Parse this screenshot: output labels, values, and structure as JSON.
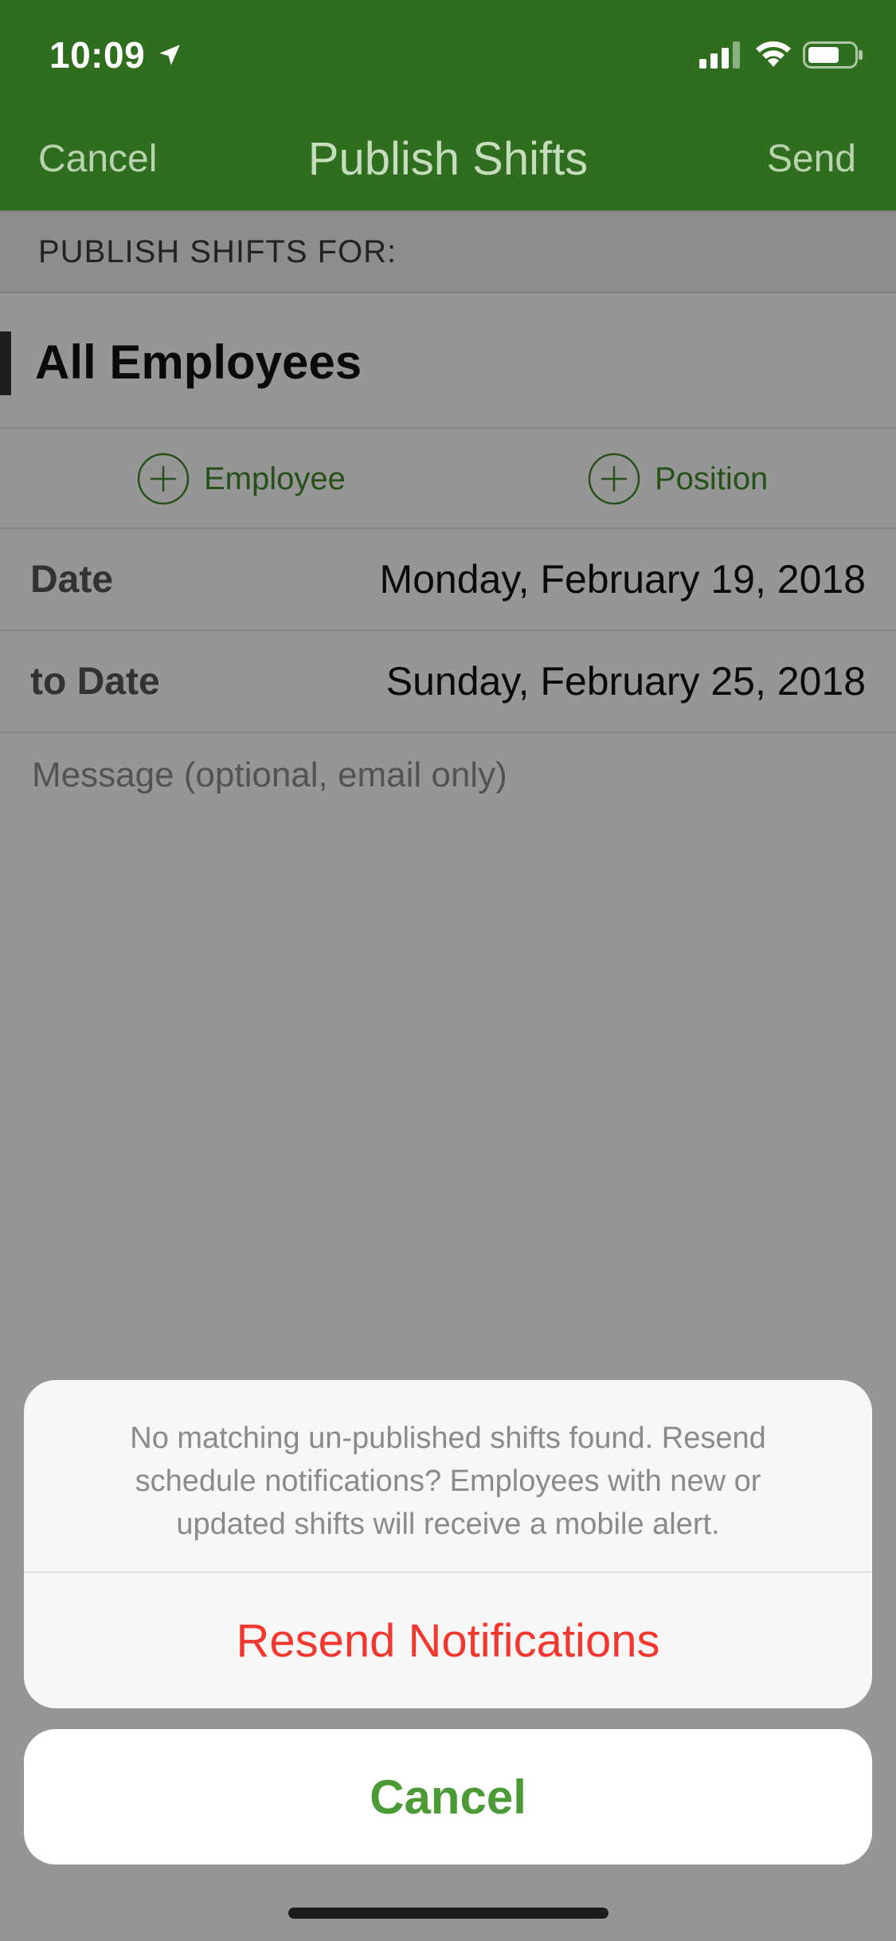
{
  "status_bar": {
    "time": "10:09"
  },
  "nav": {
    "cancel_label": "Cancel",
    "title": "Publish Shifts",
    "send_label": "Send"
  },
  "form": {
    "section_header": "PUBLISH SHIFTS FOR:",
    "all_employees": "All Employees",
    "add_employee_label": "Employee",
    "add_position_label": "Position",
    "date_label": "Date",
    "date_value": "Monday, February 19, 2018",
    "to_date_label": "to Date",
    "to_date_value": "Sunday, February 25, 2018",
    "message_placeholder": "Message (optional, email only)"
  },
  "action_sheet": {
    "message": "No matching un-published shifts found. Resend schedule notifications? Employees with new or updated shifts will receive a mobile alert.",
    "resend_label": "Resend Notifications",
    "cancel_label": "Cancel"
  },
  "colors": {
    "nav_green": "#2f6e1f",
    "accent_green": "#4b9a35",
    "destructive_red": "#f2372f"
  },
  "icons": {
    "location": "location-arrow-icon",
    "signal": "cellular-signal-icon",
    "wifi": "wifi-icon",
    "battery": "battery-icon",
    "add": "plus-circle-icon"
  }
}
